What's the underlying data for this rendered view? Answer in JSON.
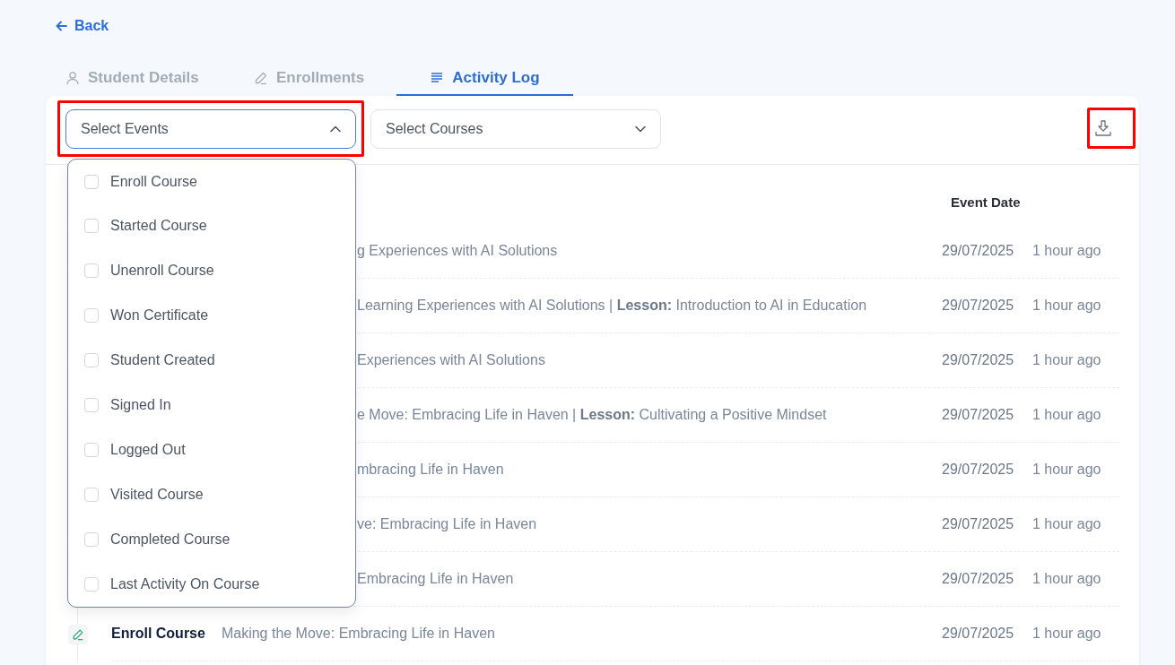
{
  "back": {
    "label": "Back"
  },
  "tabs": [
    {
      "label": "Student Details",
      "selected": false
    },
    {
      "label": "Enrollments",
      "selected": false
    },
    {
      "label": "Activity Log",
      "selected": true
    }
  ],
  "filters": [
    {
      "placeholder": "Select Events",
      "expanded": true,
      "highlighted": true
    },
    {
      "placeholder": "Select Courses",
      "expanded": false,
      "highlighted": false
    }
  ],
  "download": {
    "highlighted": true
  },
  "event_options": [
    {
      "label": "Enroll Course",
      "checked": false
    },
    {
      "label": "Started Course",
      "checked": false
    },
    {
      "label": "Unenroll Course",
      "checked": false
    },
    {
      "label": "Won Certificate",
      "checked": false
    },
    {
      "label": "Student Created",
      "checked": false
    },
    {
      "label": "Signed In",
      "checked": false
    },
    {
      "label": "Logged Out",
      "checked": false
    },
    {
      "label": "Visited Course",
      "checked": false
    },
    {
      "label": "Completed Course",
      "checked": false
    },
    {
      "label": "Last Activity On Course",
      "checked": false
    }
  ],
  "table": {
    "columns": [
      "Event Date"
    ],
    "rows": [
      {
        "details": "g Experiences with AI Solutions",
        "date": "29/07/2025",
        "ago": "1 hour ago"
      },
      {
        "details": "Learning Experiences with AI Solutions | **Lesson:** Introduction to AI in Education",
        "date": "29/07/2025",
        "ago": "1 hour ago"
      },
      {
        "details": "Experiences with AI Solutions",
        "date": "29/07/2025",
        "ago": "1 hour ago"
      },
      {
        "details": "e Move: Embracing Life in Haven | **Lesson:** Cultivating a Positive Mindset",
        "date": "29/07/2025",
        "ago": "1 hour ago"
      },
      {
        "details": "mbracing Life in Haven",
        "date": "29/07/2025",
        "ago": "1 hour ago"
      },
      {
        "details": "ve: Embracing Life in Haven",
        "date": "29/07/2025",
        "ago": "1 hour ago"
      },
      {
        "details": "Embracing Life in Haven",
        "date": "29/07/2025",
        "ago": "1 hour ago"
      },
      {
        "event": "Enroll Course",
        "details": "Making the Move: Embracing Life in Haven",
        "date": "29/07/2025",
        "ago": "1 hour ago"
      }
    ]
  }
}
